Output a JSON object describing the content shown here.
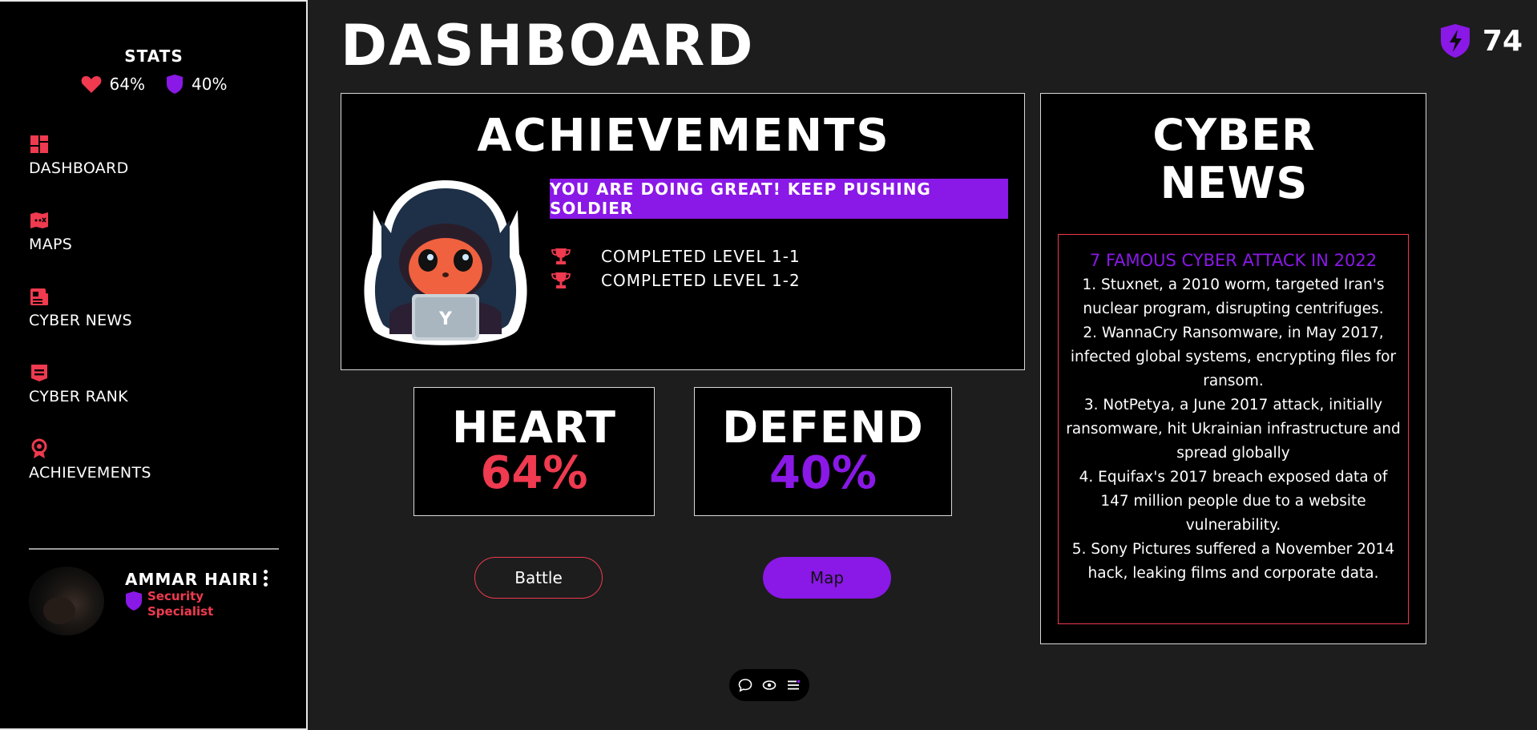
{
  "sidebar": {
    "stats_title": "STATS",
    "heart_stat": "64%",
    "defend_stat": "40%",
    "nav": [
      {
        "label": "DASHBOARD",
        "icon": "dashboard-icon"
      },
      {
        "label": "MAPS",
        "icon": "map-icon"
      },
      {
        "label": "CYBER NEWS",
        "icon": "newspaper-icon"
      },
      {
        "label": "CYBER RANK",
        "icon": "rank-icon"
      },
      {
        "label": "ACHIEVEMENTS",
        "icon": "award-icon"
      }
    ],
    "profile": {
      "name": "AMMAR HAIRI",
      "role": "Security Specialist"
    }
  },
  "header": {
    "title": "DASHBOARD",
    "points": "74"
  },
  "achievements": {
    "title": "ACHIEVEMENTS",
    "banner": "YOU ARE DOING GREAT! KEEP PUSHING SOLDIER",
    "mascot_letter": "Y",
    "items": [
      "COMPLETED LEVEL 1-1",
      "COMPLETED LEVEL 1-2"
    ]
  },
  "cards": {
    "heart": {
      "title": "HEART",
      "value": "64%"
    },
    "defend": {
      "title": "DEFEND",
      "value": "40%"
    }
  },
  "buttons": {
    "battle": "Battle",
    "map": "Map"
  },
  "news": {
    "title_line1": "CYBER",
    "title_line2": "NEWS",
    "heading": "7 FAMOUS CYBER ATTACK IN 2022",
    "items": [
      "1. Stuxnet, a 2010 worm, targeted Iran's nuclear program, disrupting centrifuges.",
      "2. WannaCry Ransomware, in May 2017, infected global systems, encrypting files for ransom.",
      "3. NotPetya, a June 2017 attack, initially ransomware, hit Ukrainian infrastructure and spread globally",
      "4. Equifax's 2017 breach exposed data of 147 million people due to a website vulnerability.",
      "5. Sony Pictures suffered a November 2014 hack, leaking films and corporate data."
    ]
  },
  "colors": {
    "accent_red": "#ef3a4f",
    "accent_purple": "#8a18e6",
    "background": "#1d1d1d",
    "panel": "#000000"
  }
}
